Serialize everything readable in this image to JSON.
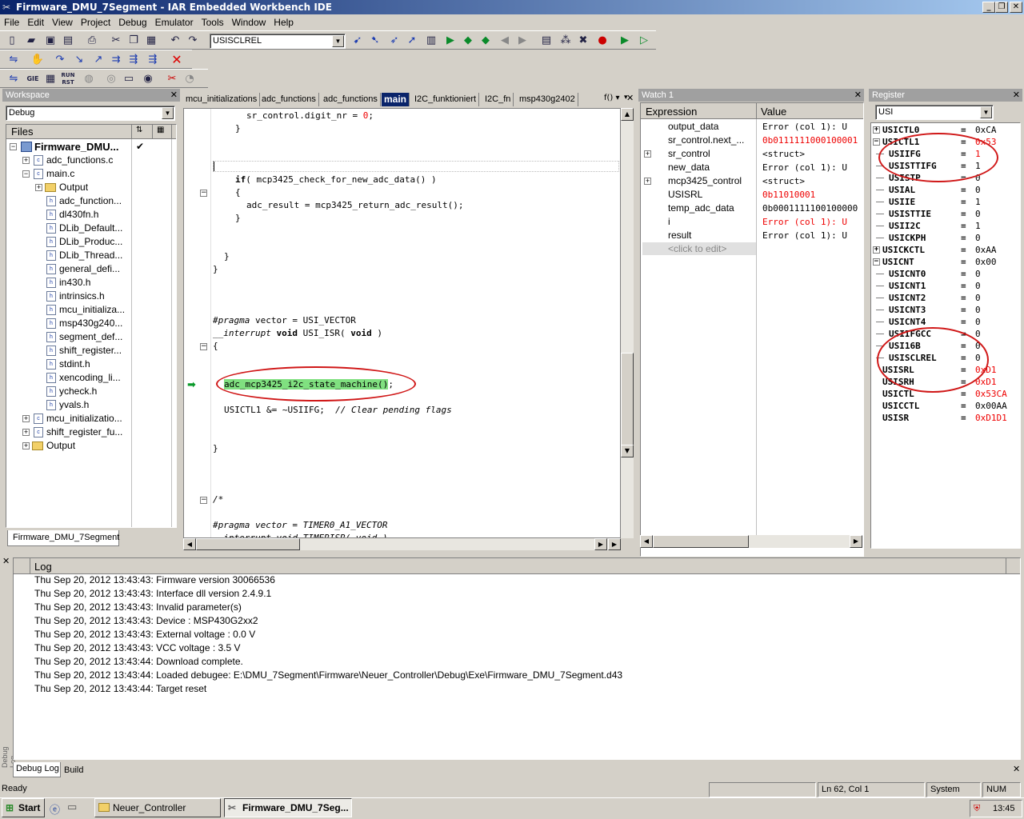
{
  "window": {
    "title": "Firmware_DMU_7Segment - IAR Embedded Workbench IDE"
  },
  "menu": [
    "File",
    "Edit",
    "View",
    "Project",
    "Debug",
    "Emulator",
    "Tools",
    "Window",
    "Help"
  ],
  "toolbar": {
    "combo_value": "USISCLREL"
  },
  "workspace": {
    "title": "Workspace",
    "config": "Debug",
    "files_header": "Files",
    "tab": "Firmware_DMU_7Segment",
    "tree": [
      {
        "label": "Firmware_DMU...",
        "check": "✔"
      },
      {
        "label": "adc_functions.c"
      },
      {
        "label": "main.c"
      },
      {
        "label": "Output"
      },
      {
        "label": "adc_function..."
      },
      {
        "label": "dl430fn.h"
      },
      {
        "label": "DLib_Default..."
      },
      {
        "label": "DLib_Produc..."
      },
      {
        "label": "DLib_Thread..."
      },
      {
        "label": "general_defi..."
      },
      {
        "label": "in430.h"
      },
      {
        "label": "intrinsics.h"
      },
      {
        "label": "mcu_initializa..."
      },
      {
        "label": "msp430g240..."
      },
      {
        "label": "segment_def..."
      },
      {
        "label": "shift_register..."
      },
      {
        "label": "stdint.h"
      },
      {
        "label": "xencoding_li..."
      },
      {
        "label": "ycheck.h"
      },
      {
        "label": "yvals.h"
      },
      {
        "label": "mcu_initializatio..."
      },
      {
        "label": "shift_register_fu..."
      },
      {
        "label": "Output"
      }
    ]
  },
  "editor": {
    "tabs": [
      "mcu_initializations",
      "adc_functions",
      "adc_functions",
      "main",
      "I2C_funktioniert",
      "I2C_fn",
      "msp430g2402"
    ],
    "tab_menu": "f()",
    "code": {
      "l1a": "sr_control.digit_nr = ",
      "l1b": "0",
      "l1c": ";",
      "brace_close": "}",
      "if_kw": "if",
      "if_rest": "( mcp3425_check_for_new_adc_data() )",
      "brace_open": "{",
      "adc_line": "adc_result = mcp3425_return_adc_result();",
      "pragma1_a": "#pragma",
      "pragma1_b": " vector = USI_VECTOR",
      "interrupt_kw": "__interrupt",
      "void_kw": "void",
      "isr_name": " USI_ISR( ",
      "void_kw2": "void",
      "isr_end": " )",
      "sm_call": "adc_mcp3425_i2c_state_machine()",
      "sm_semi": ";",
      "usictl_line": "USICTL1 &= ~USIIFG;  ",
      "usictl_comment": "// Clear pending flags",
      "comment_open": "/*",
      "pragma2": "#pragma vector = TIMER0_A1_VECTOR",
      "cut_line": "__interrupt void TIMERISR( void )"
    }
  },
  "watch": {
    "title": "Watch 1",
    "col_expression": "Expression",
    "col_value": "Value",
    "rows": [
      {
        "expr": "output_data",
        "value": "Error (col 1): U",
        "red": false,
        "expand": false
      },
      {
        "expr": "sr_control.next_...",
        "value": "0b0111111000100001",
        "red": true,
        "expand": false
      },
      {
        "expr": "sr_control",
        "value": "<struct>",
        "red": false,
        "expand": true
      },
      {
        "expr": "new_data",
        "value": "Error (col 1): U",
        "red": false,
        "expand": false
      },
      {
        "expr": "mcp3425_control",
        "value": "<struct>",
        "red": false,
        "expand": true
      },
      {
        "expr": "USISRL",
        "value": "0b11010001",
        "red": true,
        "expand": false
      },
      {
        "expr": "temp_adc_data",
        "value": "0b0001111100100000",
        "red": false,
        "expand": false
      },
      {
        "expr": "i",
        "value": "Error (col 1): U",
        "red": true,
        "expand": false
      },
      {
        "expr": "result",
        "value": "Error (col 1): U",
        "red": false,
        "expand": false
      }
    ],
    "click_to_edit": "<click to edit>"
  },
  "register": {
    "title": "Register",
    "group": "USI",
    "rows": [
      {
        "name": "USICTL0",
        "val": "0xCA",
        "red": false,
        "tree": "plus",
        "indent": 0
      },
      {
        "name": "USICTL1",
        "val": "0x53",
        "red": true,
        "tree": "minus",
        "indent": 0
      },
      {
        "name": "USIIFG",
        "val": "1",
        "red": true,
        "tree": "leaf",
        "indent": 1
      },
      {
        "name": "USISTTIFG",
        "val": "1",
        "red": false,
        "tree": "leaf",
        "indent": 1
      },
      {
        "name": "USISTP",
        "val": "0",
        "red": false,
        "tree": "leaf",
        "indent": 1
      },
      {
        "name": "USIAL",
        "val": "0",
        "red": false,
        "tree": "leaf",
        "indent": 1
      },
      {
        "name": "USIIE",
        "val": "1",
        "red": false,
        "tree": "leaf",
        "indent": 1
      },
      {
        "name": "USISTTIE",
        "val": "0",
        "red": false,
        "tree": "leaf",
        "indent": 1
      },
      {
        "name": "USII2C",
        "val": "1",
        "red": false,
        "tree": "leaf",
        "indent": 1
      },
      {
        "name": "USICKPH",
        "val": "0",
        "red": false,
        "tree": "leaf",
        "indent": 1
      },
      {
        "name": "USICKCTL",
        "val": "0xAA",
        "red": false,
        "tree": "plus",
        "indent": 0
      },
      {
        "name": "USICNT",
        "val": "0x00",
        "red": false,
        "tree": "minus",
        "indent": 0
      },
      {
        "name": "USICNT0",
        "val": "0",
        "red": false,
        "tree": "leaf",
        "indent": 1
      },
      {
        "name": "USICNT1",
        "val": "0",
        "red": false,
        "tree": "leaf",
        "indent": 1
      },
      {
        "name": "USICNT2",
        "val": "0",
        "red": false,
        "tree": "leaf",
        "indent": 1
      },
      {
        "name": "USICNT3",
        "val": "0",
        "red": false,
        "tree": "leaf",
        "indent": 1
      },
      {
        "name": "USICNT4",
        "val": "0",
        "red": false,
        "tree": "leaf",
        "indent": 1
      },
      {
        "name": "USIIFGCC",
        "val": "0",
        "red": false,
        "tree": "leaf",
        "indent": 1
      },
      {
        "name": "USI16B",
        "val": "0",
        "red": false,
        "tree": "leaf",
        "indent": 1
      },
      {
        "name": "USISCLREL",
        "val": "0",
        "red": false,
        "tree": "leaf",
        "indent": 1
      },
      {
        "name": "USISRL",
        "val": "0xD1",
        "red": true,
        "tree": "none",
        "indent": 0
      },
      {
        "name": "USISRH",
        "val": "0xD1",
        "red": true,
        "tree": "none",
        "indent": 0
      },
      {
        "name": "USICTL",
        "val": "0x53CA",
        "red": true,
        "tree": "none",
        "indent": 0
      },
      {
        "name": "USICCTL",
        "val": "0x00AA",
        "red": false,
        "tree": "none",
        "indent": 0
      },
      {
        "name": "USISR",
        "val": "0xD1D1",
        "red": true,
        "tree": "none",
        "indent": 0
      }
    ]
  },
  "log": {
    "side_label": "Debug Log",
    "header": "Log",
    "lines": [
      "Thu Sep 20, 2012 13:43:43: Firmware version 30066536",
      "Thu Sep 20, 2012 13:43:43: Interface dll version 2.4.9.1",
      "Thu Sep 20, 2012 13:43:43: Invalid parameter(s)",
      "Thu Sep 20, 2012 13:43:43: Device : MSP430G2xx2",
      "Thu Sep 20, 2012 13:43:43: External voltage : 0.0 V",
      "Thu Sep 20, 2012 13:43:43: VCC voltage : 3.5 V",
      "Thu Sep 20, 2012 13:43:44: Download complete.",
      "Thu Sep 20, 2012 13:43:44: Loaded debugee: E:\\DMU_7Segment\\Firmware\\Neuer_Controller\\Debug\\Exe\\Firmware_DMU_7Segment.d43",
      "Thu Sep 20, 2012 13:43:44: Target reset"
    ],
    "tabs": [
      "Debug Log",
      "Build"
    ]
  },
  "status": {
    "left": "Ready",
    "position": "Ln 62, Col 1",
    "mode": "System",
    "num": "NUM"
  },
  "taskbar": {
    "start": "Start",
    "items": [
      "Neuer_Controller",
      "Firmware_DMU_7Seg..."
    ],
    "clock": "13:45"
  },
  "colors": {
    "title_bar": "#0a246a",
    "highlight": "#80e080",
    "annotation": "#d01818",
    "value_changed": "#e00000"
  }
}
